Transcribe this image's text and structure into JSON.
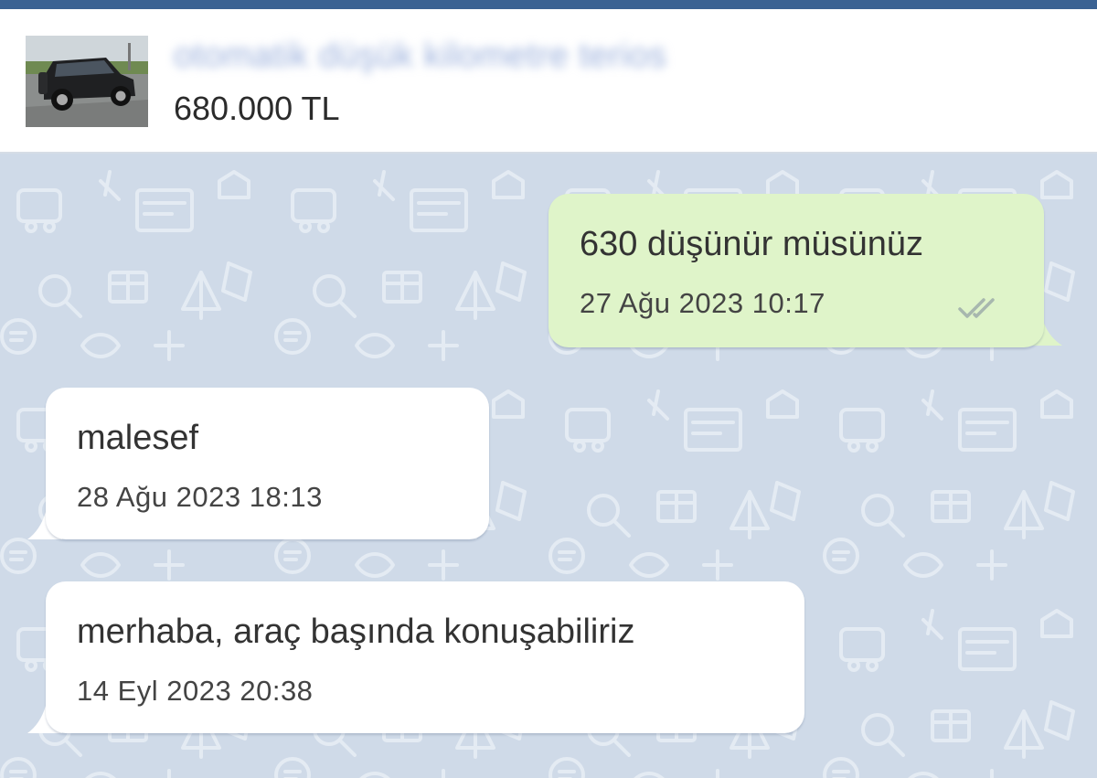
{
  "header": {
    "listing_title": "otomatik düşük kilometre terios",
    "price": "680.000 TL",
    "thumbnail_icon": "car-photo-thumbnail"
  },
  "messages": [
    {
      "direction": "outgoing",
      "text": "630 düşünür müsünüz",
      "time": "27 Ağu 2023 10:17",
      "status_icon": "double-check-icon"
    },
    {
      "direction": "incoming",
      "text": "malesef",
      "time": "28 Ağu 2023 18:13"
    },
    {
      "direction": "incoming",
      "text": "merhaba, araç başında konuşabiliriz",
      "time": "14 Eyl 2023 20:38"
    }
  ],
  "colors": {
    "top_bar": "#3a6293",
    "chat_background": "#cfdae8",
    "outgoing_bubble": "#dff4c9",
    "incoming_bubble": "#ffffff"
  }
}
